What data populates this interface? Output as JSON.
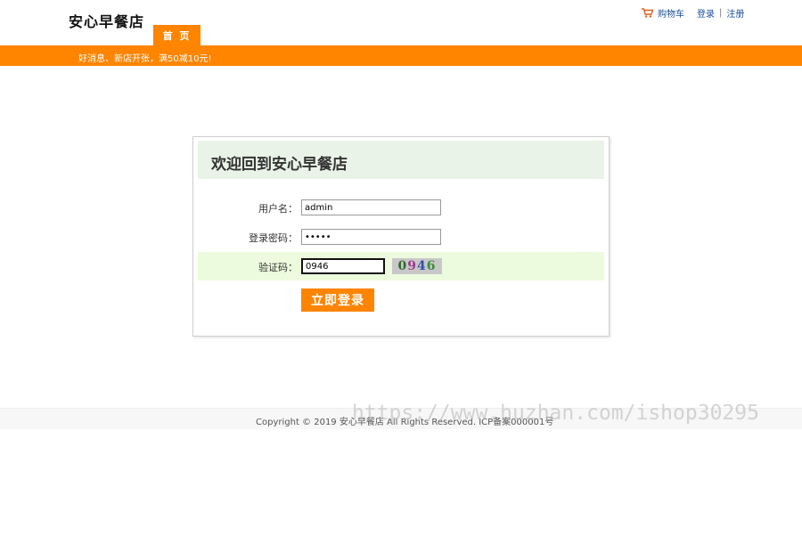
{
  "header": {
    "logo": "安心早餐店",
    "nav_home": "首 页",
    "cart": "购物车",
    "login": "登录",
    "separator": "|",
    "register": "注册"
  },
  "notice": {
    "text": "好消息、新店开张，满50减10元!"
  },
  "login_form": {
    "title": "欢迎回到安心早餐店",
    "username_label": "用户名：",
    "username_value": "admin",
    "password_label": "登录密码：",
    "password_value": "admin",
    "captcha_label": "验证码：",
    "captcha_value": "0946",
    "captcha_image_digits": [
      "0",
      "9",
      "4",
      "6"
    ],
    "submit_label": "立即登录"
  },
  "footer": {
    "copyright": "Copyright © 2019 安心早餐店 All Rights Reserved. ICP备案000001号"
  },
  "watermark": "https://www.huzhan.com/ishop30295",
  "colors": {
    "brand_orange": "#ff8400",
    "header_green": "#e9f3e7",
    "row_highlight": "#ecfbdd",
    "link_blue": "#1c4f9c"
  }
}
